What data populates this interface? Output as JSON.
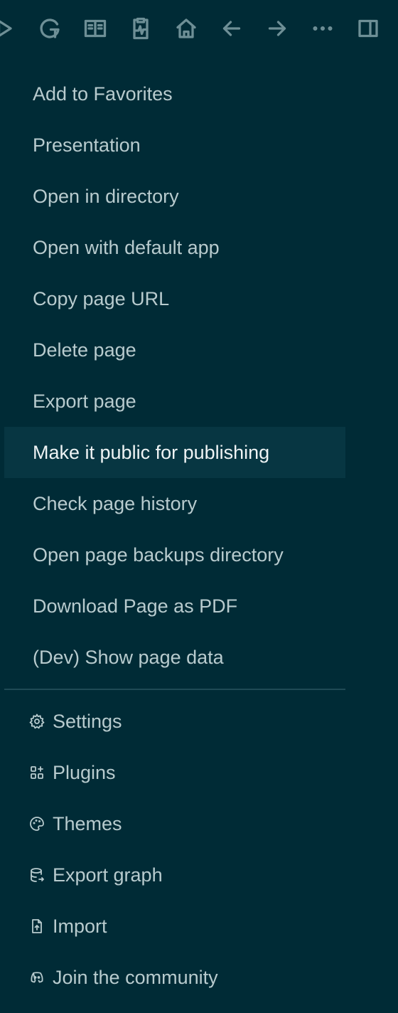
{
  "toolbar": {
    "icons": [
      "play-icon",
      "graph-g-icon",
      "book-icon",
      "clipboard-activity-icon",
      "home-icon",
      "arrow-left-icon",
      "arrow-right-icon",
      "more-icon",
      "sidebar-toggle-icon"
    ]
  },
  "page_menu": {
    "items": [
      {
        "label": "Add to Favorites"
      },
      {
        "label": "Presentation"
      },
      {
        "label": "Open in directory"
      },
      {
        "label": "Open with default app"
      },
      {
        "label": "Copy page URL"
      },
      {
        "label": "Delete page"
      },
      {
        "label": "Export page"
      },
      {
        "label": "Make it public for publishing"
      },
      {
        "label": "Check page history"
      },
      {
        "label": "Open page backups directory"
      },
      {
        "label": "Download Page as PDF"
      },
      {
        "label": "(Dev) Show page data"
      }
    ],
    "highlighted_index": 7
  },
  "app_menu": {
    "items": [
      {
        "label": "Settings",
        "icon": "gear-icon"
      },
      {
        "label": "Plugins",
        "icon": "plugins-icon"
      },
      {
        "label": "Themes",
        "icon": "palette-icon"
      },
      {
        "label": "Export graph",
        "icon": "database-export-icon"
      },
      {
        "label": "Import",
        "icon": "file-upload-icon"
      },
      {
        "label": "Join the community",
        "icon": "discord-icon"
      }
    ]
  },
  "colors": {
    "background": "#002b36",
    "highlight": "#073642",
    "text": "#b8cbce",
    "icon": "#6e8f96"
  }
}
